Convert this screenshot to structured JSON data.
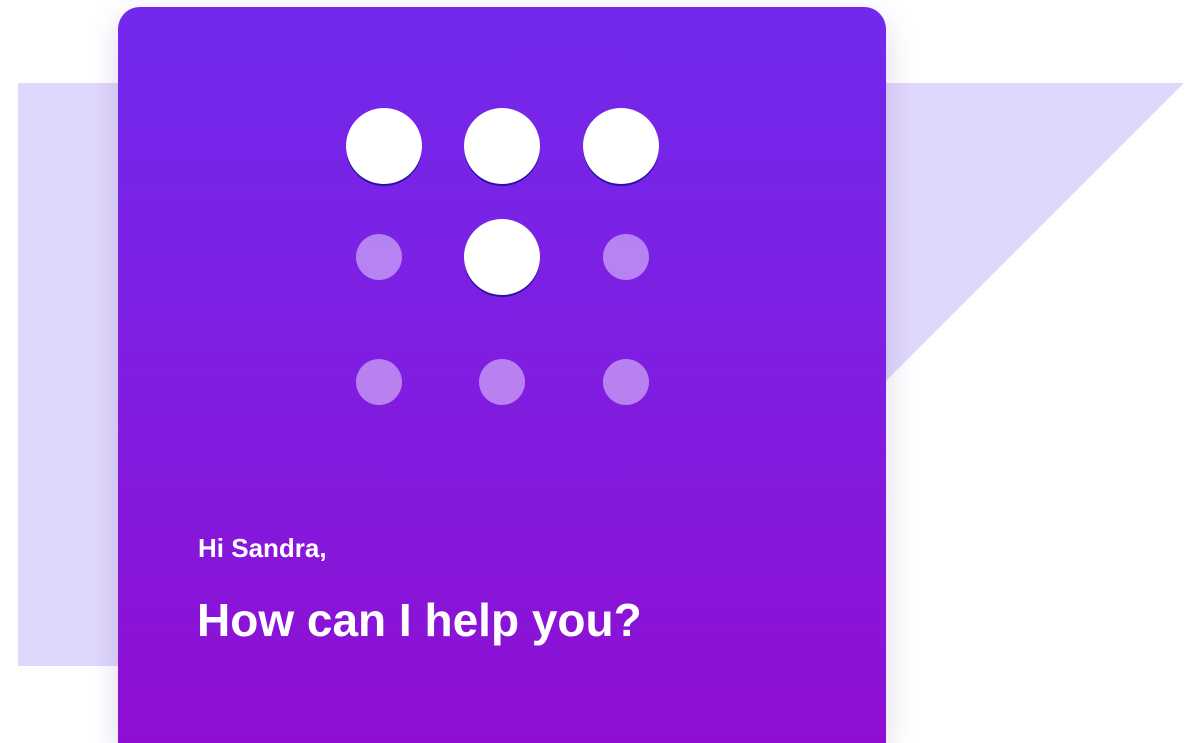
{
  "greeting": "Hi Sandra,",
  "prompt": "How can I help you?",
  "colors": {
    "card_gradient_top": "#7229ec",
    "card_gradient_bottom": "#8e0fd2",
    "backdrop": "#e0d8fc",
    "text": "#ffffff"
  },
  "logo": {
    "icon": "dot-grid-icon",
    "grid": [
      [
        "large",
        "large",
        "large"
      ],
      [
        "small",
        "large",
        "small"
      ],
      [
        "small",
        "small",
        "small"
      ]
    ]
  }
}
